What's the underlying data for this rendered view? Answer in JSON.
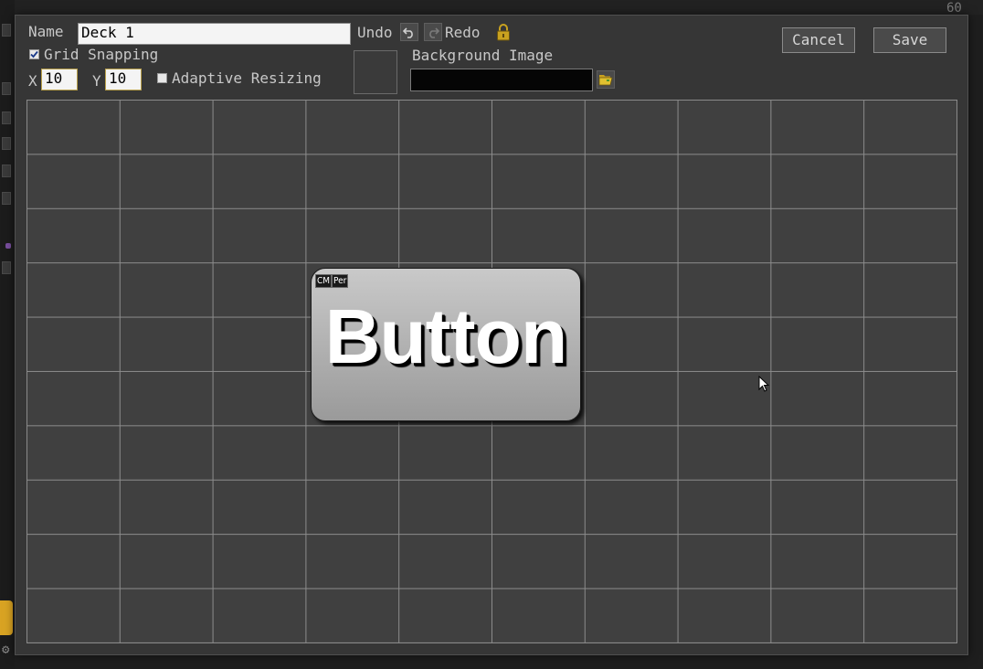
{
  "background": {
    "counter": "60"
  },
  "dialog": {
    "name_label": "Name",
    "name_value": "Deck 1",
    "undo_label": "Undo",
    "redo_label": "Redo",
    "grid_snapping_label": "Grid Snapping",
    "grid_snapping_checked": true,
    "x_label": "X",
    "x_value": "10",
    "y_label": "Y",
    "y_value": "10",
    "adaptive_resizing_label": "Adaptive Resizing",
    "adaptive_resizing_checked": false,
    "background_image_label": "Background Image",
    "background_image_value": "",
    "cancel_label": "Cancel",
    "save_label": "Save"
  },
  "canvas": {
    "columns": 10,
    "rows": 10,
    "button": {
      "label": "Button",
      "badges": [
        "CM",
        "Per"
      ]
    }
  },
  "icons": [
    "undo-icon",
    "redo-icon",
    "lock-icon",
    "folder-open-icon",
    "checkmark-icon",
    "mouse-cursor-icon"
  ],
  "colors": {
    "dialog_bg": "#363636",
    "canvas_bg": "#404040",
    "grid_line": "#8c8c8c",
    "lock_gold": "#c9a21f",
    "folder_yellow": "#e0c030"
  }
}
